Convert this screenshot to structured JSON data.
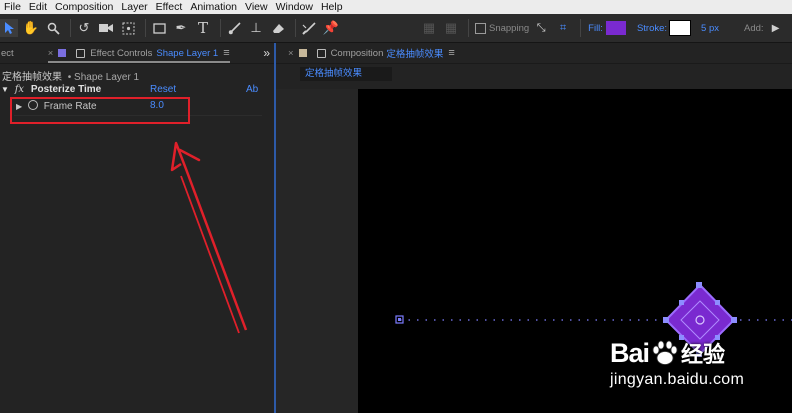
{
  "menu": [
    "File",
    "Edit",
    "Composition",
    "Layer",
    "Effect",
    "Animation",
    "View",
    "Window",
    "Help"
  ],
  "toolbar": {
    "snapping_label": "Snapping",
    "fill_label": "Fill:",
    "stroke_label": "Stroke:",
    "stroke_width": "5 px",
    "add_label": "Add:",
    "fill_color": "#7a2ad0"
  },
  "left_panel": {
    "tab_partial": "ect",
    "tab_close": "×",
    "tab_title_prefix": "Effect Controls",
    "tab_title_layer": "Shape Layer 1",
    "collapse": "»",
    "breadcrumb_comp": "定格抽帧效果",
    "breadcrumb_layer": "• Shape Layer 1",
    "effect_fx": "fx",
    "effect_name": "Posterize Time",
    "reset_label": "Reset",
    "about_label": "Ab",
    "param_label": "Frame Rate",
    "param_value": "8.0"
  },
  "right_panel": {
    "tab_close": "×",
    "tab_prefix": "Composition",
    "tab_comp_name": "定格抽帧效果",
    "comp_tab_label": "定格抽帧效果"
  },
  "watermark": {
    "brand_left": "Bai",
    "brand_right": "经验",
    "url": "jingyan.baidu.com"
  }
}
